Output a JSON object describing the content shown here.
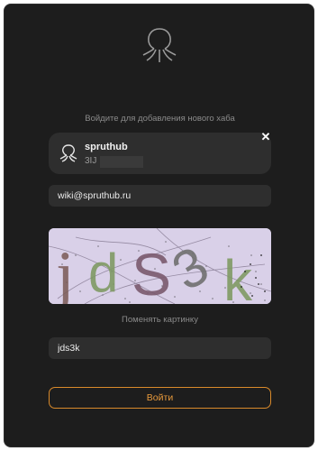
{
  "dialog": {
    "subtitle": "Войдите для добавления нового хаба",
    "hub": {
      "name": "spruthub",
      "serial_visible": "3IJ",
      "remove_icon": "close-icon",
      "logo_icon": "octopus-icon"
    },
    "email_value": "wiki@spruthub.ru",
    "captcha_text": "jdS3k",
    "refresh_label": "Поменять картинку",
    "captcha_value": "jds3k",
    "submit_label": "Войти"
  },
  "colors": {
    "background": "#1d1d1d",
    "field": "#2e2e2e",
    "accent": "#e89a3c"
  }
}
